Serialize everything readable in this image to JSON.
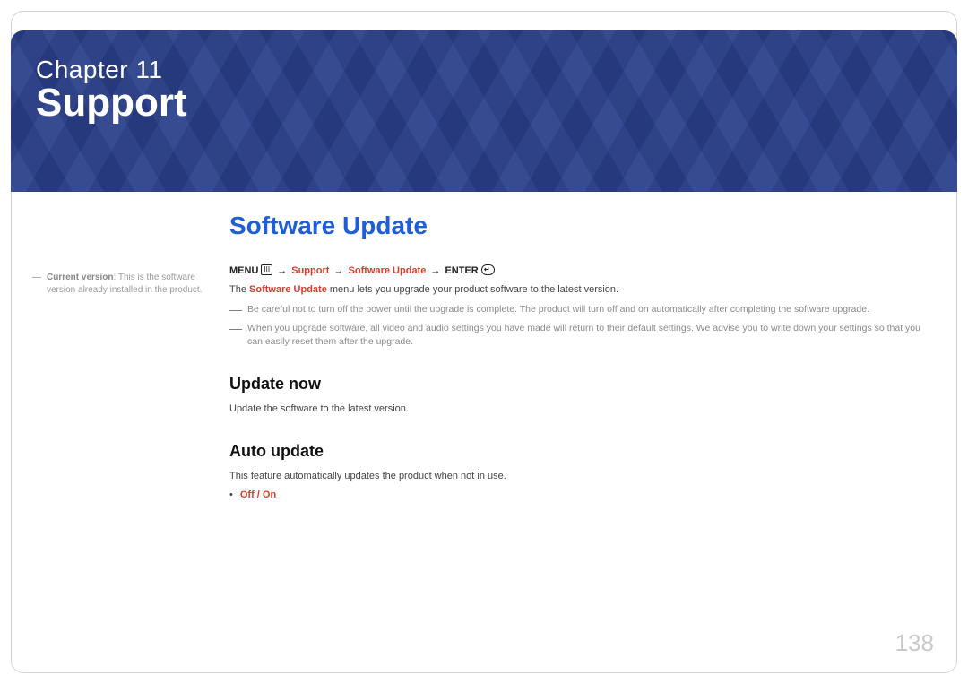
{
  "chapter": {
    "label": "Chapter 11",
    "title": "Support"
  },
  "sidebar": {
    "note_label": "Current version",
    "note_text": ": This is the software version already installed in the product."
  },
  "main": {
    "h1": "Software Update",
    "nav": {
      "menu": "MENU",
      "menu_icon": "III",
      "s1": "Support",
      "s2": "Software Update",
      "enter": "ENTER",
      "enter_icon": "↵"
    },
    "intro_pre": "The ",
    "intro_key": "Software Update",
    "intro_post": " menu lets you upgrade your product software to the latest version.",
    "note1": "Be careful not to turn off the power until the upgrade is complete. The product will turn off and on automatically after completing the software upgrade.",
    "note2": "When you upgrade software, all video and audio settings you have made will return to their default settings. We advise you to write down your settings so that you can easily reset them after the upgrade.",
    "update_now": {
      "h2": "Update now",
      "text": "Update the software to the latest version."
    },
    "auto_update": {
      "h2": "Auto update",
      "text": "This feature automatically updates the product when not in use.",
      "option": "Off / On"
    }
  },
  "page_number": "138"
}
